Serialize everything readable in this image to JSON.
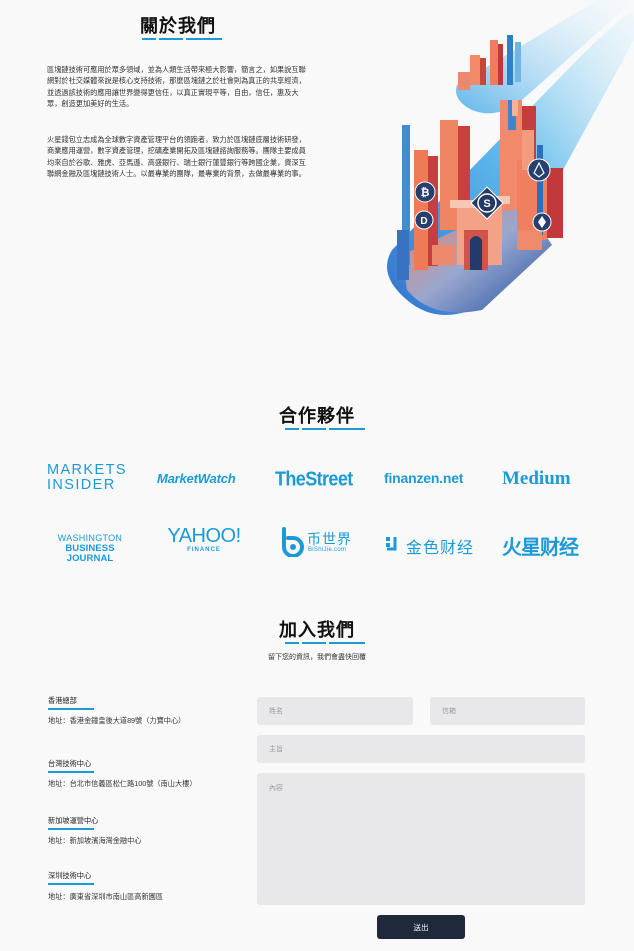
{
  "about": {
    "title": "關於我們",
    "paragraphs": [
      "區塊鏈技術可應用於眾多領域，並為人類生活帶來極大影響，簡言之，如果說互聯網對於社交媒體來說是核心支持技術，那麼區塊鏈之於社會則為真正的共享經濟，並透過該技術的應用讓世界變得更信任，以真正實現平等，自由，信任，惠及大眾，創造更加美好的生活。",
      "火星錢包立志成為全球數字資產管理平台的領跑者，致力於區塊鏈底層技術研發，商業應用運營，數字資產管理，挖礦產業開拓及區塊鏈諮詢服務等。團隊主要成員均來自於谷歌、雅虎、亞馬遜、高盛銀行、瑞士銀行蓮豐銀行等跨國企業，資深互聯網金融及區塊鏈技術人士。以最專業的團隊，最專業的背景，去做最專業的事。"
    ]
  },
  "partners": {
    "title": "合作夥伴",
    "logos": {
      "markets_insider": [
        "MARKETS",
        "INSIDER"
      ],
      "marketwatch": "MarketWatch",
      "thestreet": "TheStreet",
      "finanzen": "finanzen.net",
      "medium": "Medium",
      "wbj": [
        "WASHINGTON",
        "BUSINESS JOURNAL"
      ],
      "yahoo": [
        "YAHOO!",
        "FINANCE"
      ],
      "bishijie": [
        "币世界",
        "BiShiJie.com"
      ],
      "jinse": "金色财经",
      "huoxing": "火星财经"
    },
    "accent": "#1b9ad6"
  },
  "join": {
    "title": "加入我們",
    "subtitle": "留下您的資訊，我們會盡快回覆",
    "offices": [
      {
        "name": "香港總部",
        "address": "地址：香港金鐘皇後大道89號（力寶中心）"
      },
      {
        "name": "台灣技術中心",
        "address": "地址：台北市信義區松仁路100號（南山大樓）"
      },
      {
        "name": "新加坡運營中心",
        "address": "地址：新加坡濱海灣金融中心"
      },
      {
        "name": "深圳技術中心",
        "address": "地址：廣東省深圳市南山區高新園區"
      }
    ],
    "form": {
      "name_placeholder": "姓名",
      "email_placeholder": "信箱",
      "subject_placeholder": "主旨",
      "content_placeholder": "內容",
      "submit_label": "送出"
    },
    "button_color": "#1e2a3c"
  },
  "illustration": {
    "icons": [
      "bitcoin-icon",
      "dash-icon",
      "s-coin-icon",
      "eos-icon",
      "ethereum-icon"
    ]
  }
}
